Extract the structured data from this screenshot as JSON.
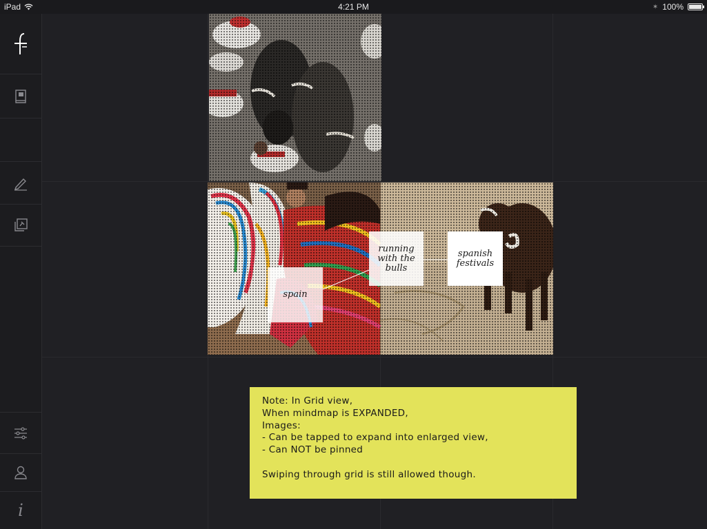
{
  "status_bar": {
    "device": "iPad",
    "time": "4:21 PM",
    "battery_label": "100%",
    "battery_level": 1.0,
    "wifi_icon": "wifi-icon",
    "bluetooth_icon": "bluetooth-icon"
  },
  "sidebar": {
    "items": [
      {
        "name": "logo",
        "icon": "logo-f-icon"
      },
      {
        "name": "notebook",
        "icon": "notebook-icon"
      },
      {
        "name": "blank",
        "icon": ""
      },
      {
        "name": "sketch",
        "icon": "pen-icon"
      },
      {
        "name": "pinned",
        "icon": "pinned-stack-icon"
      },
      {
        "name": "settings",
        "icon": "sliders-icon"
      },
      {
        "name": "profile",
        "icon": "user-icon"
      },
      {
        "name": "info",
        "icon": "info-icon"
      }
    ]
  },
  "tiles": [
    {
      "name": "running-of-bulls-photo",
      "subject": "bulls running through street"
    },
    {
      "name": "flamenco-dancers-photo",
      "subject": "dancers in colorful skirts"
    },
    {
      "name": "bull-arena-photo",
      "subject": "bull in arena"
    }
  ],
  "mindmap": {
    "nodes": [
      {
        "id": "spain",
        "label": "spain"
      },
      {
        "id": "running",
        "label": "running\nwith the\nbulls"
      },
      {
        "id": "festivals",
        "label": "spanish\nfestivals"
      }
    ]
  },
  "note": {
    "lines": [
      "Note: In Grid view,",
      "When mindmap is EXPANDED,",
      "Images:",
      "- Can be tapped to expand into enlarged view,",
      "- Can NOT be pinned",
      "",
      "Swiping through grid is still allowed though."
    ]
  },
  "colors": {
    "background": "#202024",
    "sidebar": "#1c1c1f",
    "note": "#e3e35a",
    "node_bg": "#ffffff"
  }
}
